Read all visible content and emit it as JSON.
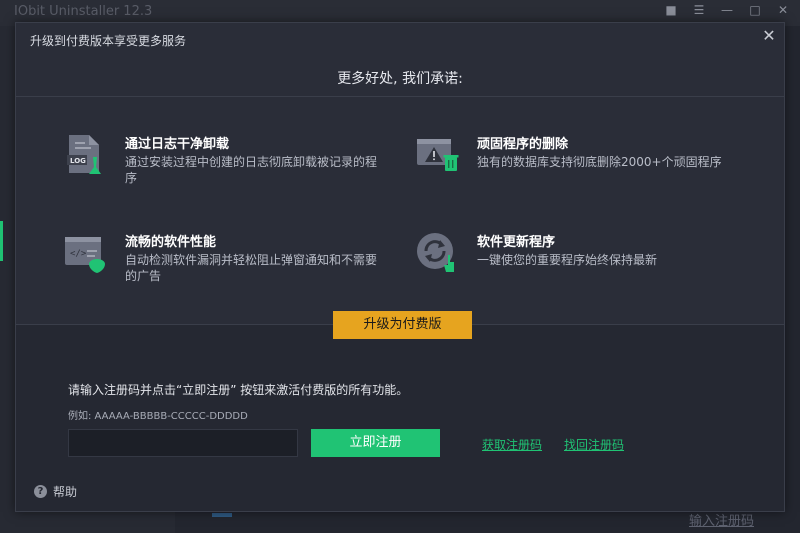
{
  "background_app": {
    "title": "IObit Uninstaller 12.3",
    "bottom_link": "输入注册码",
    "controls": [
      "bag-icon",
      "menu-icon",
      "minimize-icon",
      "maximize-icon",
      "close-icon"
    ]
  },
  "dialog": {
    "title": "升级到付费版本享受更多服务",
    "headline": "更多好处, 我们承诺:",
    "features": [
      {
        "icon": "log-file-icon",
        "title": "通过日志干净卸载",
        "desc": "通过安装过程中创建的日志彻底卸载被记录的程序"
      },
      {
        "icon": "warning-window-icon",
        "title": "顽固程序的删除",
        "desc": "独有的数据库支持彻底删除2000+个顽固程序"
      },
      {
        "icon": "code-shield-icon",
        "title": "流畅的软件性能",
        "desc": "自动检测软件漏洞并轻松阻止弹窗通知和不需要的广告"
      },
      {
        "icon": "refresh-click-icon",
        "title": "软件更新程序",
        "desc": "一键使您的重要程序始终保持最新"
      }
    ],
    "upgrade_label": "升级为付费版",
    "register": {
      "prompt": "请输入注册码并点击“立即注册” 按钮来激活付费版的所有功能。",
      "example": "例如: AAAAA-BBBBB-CCCCC-DDDDD",
      "input_value": "",
      "button_label": "立即注册",
      "get_code_link": "获取注册码",
      "retrieve_code_link": "找回注册码"
    },
    "help_label": "帮助"
  },
  "colors": {
    "accent_green": "#20c374",
    "upgrade_orange": "#e6a41f",
    "dialog_bg": "#2a2d38",
    "lower_bg": "#252832"
  }
}
